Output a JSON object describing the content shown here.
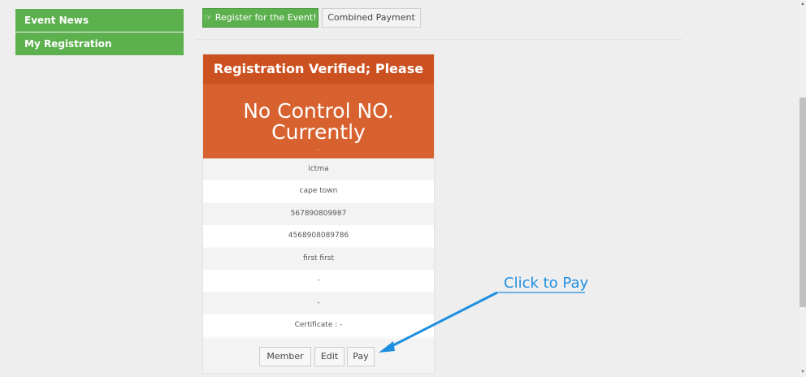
{
  "sidebar": {
    "items": [
      {
        "label": "Event News"
      },
      {
        "label": "My Registration"
      }
    ]
  },
  "toolbar": {
    "register_label": "☞ Register for the Event!",
    "combined_label": "Combined Payment"
  },
  "card": {
    "title": "Registration Verified; Please Pay",
    "big_line1": "No Control NO.",
    "big_line2": "Currently",
    "big_dot": "-",
    "rows": [
      "ictma",
      "cape town",
      "567890809987",
      "4568908089786",
      "first first",
      "-",
      "-",
      "Certificate : -"
    ],
    "buttons": {
      "member": "Member",
      "edit": "Edit",
      "pay": "Pay"
    }
  },
  "annotation": {
    "text": "Click to Pay",
    "color": "#1e8fe0"
  },
  "colors": {
    "green": "#5db04e",
    "orange_header": "#cc5120",
    "orange_body": "#d8622f"
  }
}
